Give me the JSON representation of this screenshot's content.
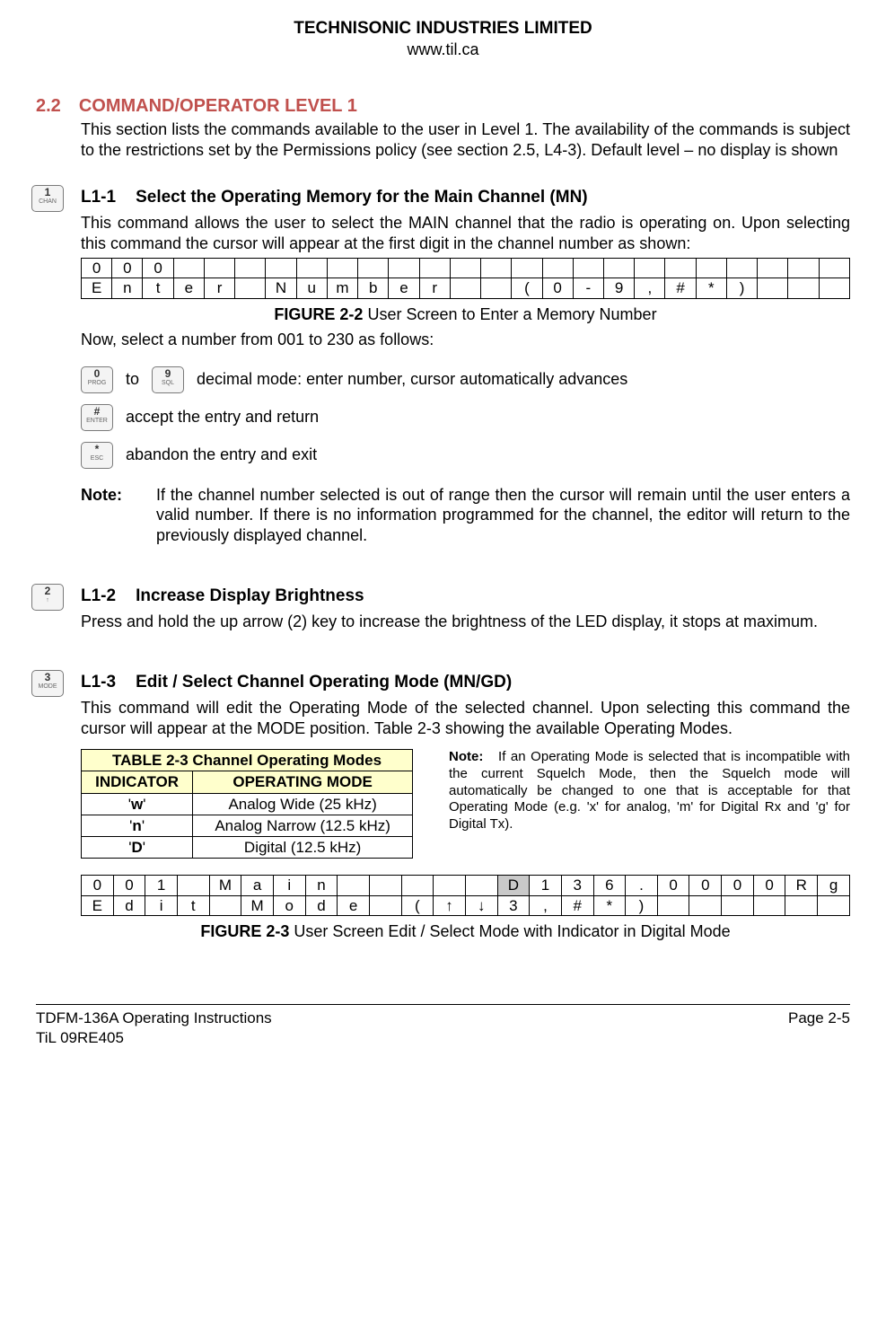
{
  "header": {
    "company": "TECHNISONIC INDUSTRIES LIMITED",
    "url": "www.til.ca"
  },
  "section": {
    "num": "2.2",
    "title": "COMMAND/OPERATOR LEVEL 1",
    "intro": "This section lists the commands available to the user in Level 1. The availability of the commands is subject to the restrictions set by the Permissions policy (see section 2.5, L4-3). Default level – no display is shown"
  },
  "l1_1": {
    "margin_key": {
      "top": "1",
      "bot": "CHAN"
    },
    "num": "L1-1",
    "title": "Select the Operating Memory for the Main Channel (MN)",
    "para": "This command allows the user to select the MAIN channel that the radio is operating on. Upon selecting this command the cursor will appear at the first digit in the channel number as shown:",
    "lcd_row1": [
      "0",
      "0",
      "0",
      "",
      "",
      "",
      "",
      "",
      "",
      "",
      "",
      "",
      "",
      "",
      "",
      "",
      "",
      "",
      "",
      "",
      "",
      "",
      "",
      "",
      ""
    ],
    "lcd_row2": [
      "E",
      "n",
      "t",
      "e",
      "r",
      "",
      "N",
      "u",
      "m",
      "b",
      "e",
      "r",
      "",
      "",
      "(",
      "0",
      "-",
      "9",
      ",",
      "#",
      "*",
      ")",
      "",
      "",
      ""
    ],
    "fig_label": "FIGURE 2-2",
    "fig_text": " User Screen to Enter a Memory Number",
    "now_select": "Now, select a number from 001 to 230 as follows:",
    "key_0": {
      "top": "0",
      "bot": "PROG"
    },
    "to_word": "to",
    "key_9": {
      "top": "9",
      "bot": "SQL"
    },
    "decimal_text": "decimal mode: enter number, cursor automatically advances",
    "key_hash": {
      "top": "#",
      "bot": "ENTER"
    },
    "accept_text": "accept the entry and return",
    "key_star": {
      "top": "*",
      "bot": "ESC"
    },
    "abandon_text": "abandon the entry and exit",
    "note_label": "Note:",
    "note_text": "If the channel number selected is out of range then the cursor will remain until the user enters a valid number. If there is no information programmed for the channel, the editor will return to the previously displayed channel."
  },
  "l1_2": {
    "margin_key": {
      "top": "2",
      "bot": "↑"
    },
    "num": "L1-2",
    "title": "Increase Display Brightness",
    "para": "Press and hold the up arrow (2) key to increase the brightness of the LED display, it stops at maximum."
  },
  "l1_3": {
    "margin_key": {
      "top": "3",
      "bot": "MODE"
    },
    "num": "L1-3",
    "title": "Edit / Select Channel Operating Mode (MN/GD)",
    "para": "This command will edit the Operating Mode of the selected channel. Upon selecting this command the cursor will appear at the MODE position. Table 2-3 showing the available Operating Modes.",
    "table_title": "TABLE 2-3 Channel Operating Modes",
    "col1": "INDICATOR",
    "col2": "OPERATING MODE",
    "rows": [
      {
        "ind": "'w'",
        "mode": "Analog Wide (25 kHz)"
      },
      {
        "ind": "'n'",
        "mode": "Analog Narrow (12.5 kHz)"
      },
      {
        "ind": "'D'",
        "mode": "Digital (12.5 kHz)"
      }
    ],
    "side_note_label": "Note:",
    "side_note": "If an Operating Mode is selected that is incompatible with the current Squelch Mode, then the Squelch mode will automatically be changed to one that is acceptable for that Operating Mode (e.g. 'x' for analog, 'm' for Digital Rx and 'g' for Digital Tx).",
    "lcd_row1": [
      "0",
      "0",
      "1",
      "",
      "M",
      "a",
      "i",
      "n",
      "",
      "",
      "",
      "",
      "",
      "D",
      "1",
      "3",
      "6",
      ".",
      "0",
      "0",
      "0",
      "0",
      "R",
      "g"
    ],
    "lcd_row2": [
      "E",
      "d",
      "i",
      "t",
      "",
      "M",
      "o",
      "d",
      "e",
      "",
      "(",
      "↑",
      "↓",
      "3",
      ",",
      "#",
      "*",
      ")",
      "",
      "",
      "",
      "",
      "",
      ""
    ],
    "fig_label": "FIGURE 2-3",
    "fig_text": " User Screen Edit / Select Mode with Indicator in Digital Mode"
  },
  "footer": {
    "left1": "TDFM-136A    Operating Instructions",
    "left2": "TiL 09RE405",
    "right": "Page 2-5"
  }
}
